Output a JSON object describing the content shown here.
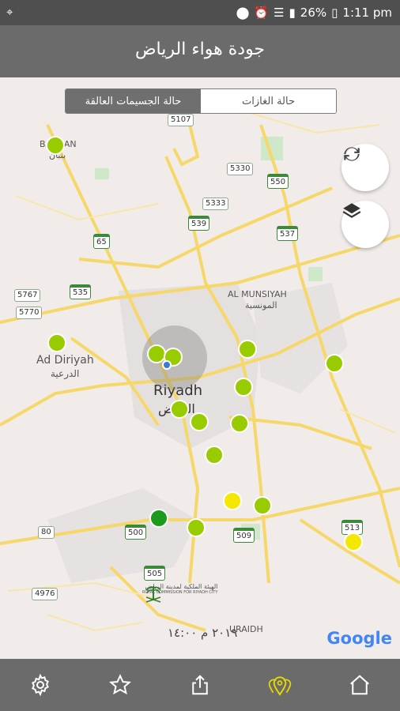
{
  "status_bar": {
    "battery": "26%",
    "time": "1:11 pm",
    "icons": [
      "location-signal-icon",
      "location-pin-icon",
      "alarm-icon",
      "wifi-icon",
      "signal-icon",
      "battery-icon"
    ]
  },
  "header": {
    "title": "جودة هواء الرياض"
  },
  "segment": {
    "gases_label": "حالة الغازات",
    "particles_label": "حالة الجسيمات العالقة",
    "selected": "particles"
  },
  "map": {
    "place_labels": {
      "riyadh_en": "Riyadh",
      "riyadh_ar": "الرياض",
      "ad_diriyah_en": "Ad Diriyah",
      "ad_diriyah_ar": "الدرعية",
      "al_munsiyah_en": "AL MUNSIYAH",
      "al_munsiyah_ar": "المونسية",
      "banban_en": "BANBAN",
      "banban_ar": "بنبان",
      "uraidh": "URAIDH"
    },
    "road_shields": [
      "5107",
      "5330",
      "550",
      "5333",
      "539",
      "537",
      "65",
      "535",
      "5767",
      "5770",
      "80",
      "500",
      "509",
      "513",
      "505",
      "4976"
    ],
    "timestamp": "٢٠١٩ م ١٤:٠٠",
    "logo_text_ar": "الهيئة الملكية لمدينة الرياض",
    "logo_text_en": "ROYAL COMMISSION FOR RIYADH CITY",
    "google": "Google",
    "marker_colors": {
      "good": "#99cc00",
      "very_good": "#1b9a1b",
      "moderate": "#f4e800"
    }
  },
  "nav": {
    "items": [
      "settings-icon",
      "favorites-icon",
      "share-icon",
      "stations-icon",
      "home-icon"
    ],
    "active": "stations-icon",
    "active_color": "#e6d800"
  },
  "colors": {
    "status_bar": "#4f4f4f",
    "header": "#6b6b6b",
    "map_bg": "#f1ecea",
    "road_major": "#f6d76a"
  }
}
